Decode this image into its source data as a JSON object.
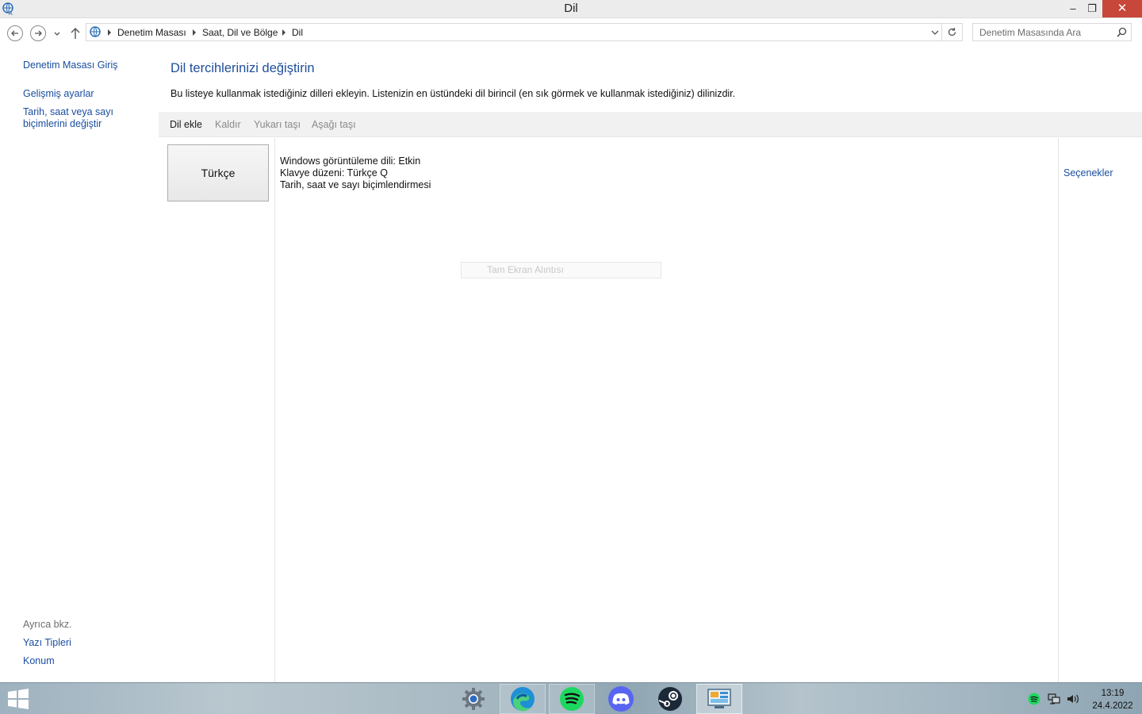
{
  "window": {
    "title": "Dil",
    "minimize_glyph": "–",
    "restore_glyph": "❐",
    "close_glyph": "✕"
  },
  "address": {
    "breadcrumbs": [
      "Denetim Masası",
      "Saat, Dil ve Bölge",
      "Dil"
    ],
    "search_placeholder": "Denetim Masasında Ara"
  },
  "sidebar": {
    "links": [
      "Denetim Masası Giriş",
      "Gelişmiş ayarlar",
      "Tarih, saat veya sayı biçimlerini değiştir"
    ],
    "see_also_title": "Ayrıca bkz.",
    "see_also_links": [
      "Yazı Tipleri",
      "Konum"
    ]
  },
  "main": {
    "title": "Dil tercihlerinizi değiştirin",
    "description": "Bu listeye kullanmak istediğiniz dilleri ekleyin. Listenizin en üstündeki dil birincil (en sık görmek ve kullanmak istediğiniz) dilinizdir.",
    "toolbar": [
      "Dil ekle",
      "Kaldır",
      "Yukarı taşı",
      "Aşağı taşı"
    ],
    "language": {
      "name": "Türkçe",
      "details": [
        "Windows görüntüleme dili: Etkin",
        "Klavye düzeni: Türkçe Q",
        "Tarih, saat ve sayı biçimlendirmesi"
      ],
      "options_label": "Seçenekler"
    },
    "ghost_label": "Tam Ekran Alıntısı"
  },
  "taskbar": {
    "apps": [
      "settings-icon",
      "edge-icon",
      "spotify-icon",
      "discord-icon",
      "steam-icon",
      "control-panel-icon"
    ],
    "time": "13:19",
    "date": "24.4.2022"
  },
  "colors": {
    "link": "#1a4ea0",
    "title_blue": "#1d4f9c",
    "close_red": "#c7473a",
    "spotify_green": "#1ed760",
    "discord_blurple": "#5865f2"
  }
}
